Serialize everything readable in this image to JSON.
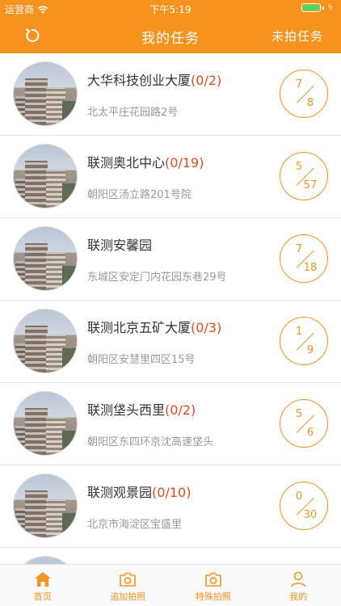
{
  "status_bar": {
    "carrier": "运营商",
    "time": "下午5:19",
    "battery_color": "#4cd964"
  },
  "navbar": {
    "title": "我的任务",
    "right_button": "未拍任务",
    "left_icon": "refresh-icon"
  },
  "accent_color": "#f6921e",
  "tasks": [
    {
      "name": "大华科技创业大厦",
      "count": "(0/2)",
      "address": "北太平庄花园路2号",
      "num": "7",
      "den": "8"
    },
    {
      "name": "联测奥北中心",
      "count": "(0/19)",
      "address": "朝阳区汤立路201号院",
      "num": "5",
      "den": "57"
    },
    {
      "name": "联测安馨园",
      "count": "",
      "address": "东城区安定门内花园东巷29号",
      "num": "7",
      "den": "18"
    },
    {
      "name": "联测北京五矿大厦",
      "count": "(0/3)",
      "address": "朝阳区安慧里四区15号",
      "num": "1",
      "den": "9"
    },
    {
      "name": "联测垡头西里",
      "count": "(0/2)",
      "address": "朝阳区东四环京沈高速垡头",
      "num": "5",
      "den": "6"
    },
    {
      "name": "联测观景园",
      "count": "(0/10)",
      "address": "北京市海淀区宝盛里",
      "num": "0",
      "den": "30"
    }
  ],
  "tabbar": [
    {
      "label": "首页",
      "icon": "home-icon"
    },
    {
      "label": "追加拍照",
      "icon": "camera-icon"
    },
    {
      "label": "特殊拍照",
      "icon": "camera-icon"
    },
    {
      "label": "我的",
      "icon": "person-icon"
    }
  ]
}
